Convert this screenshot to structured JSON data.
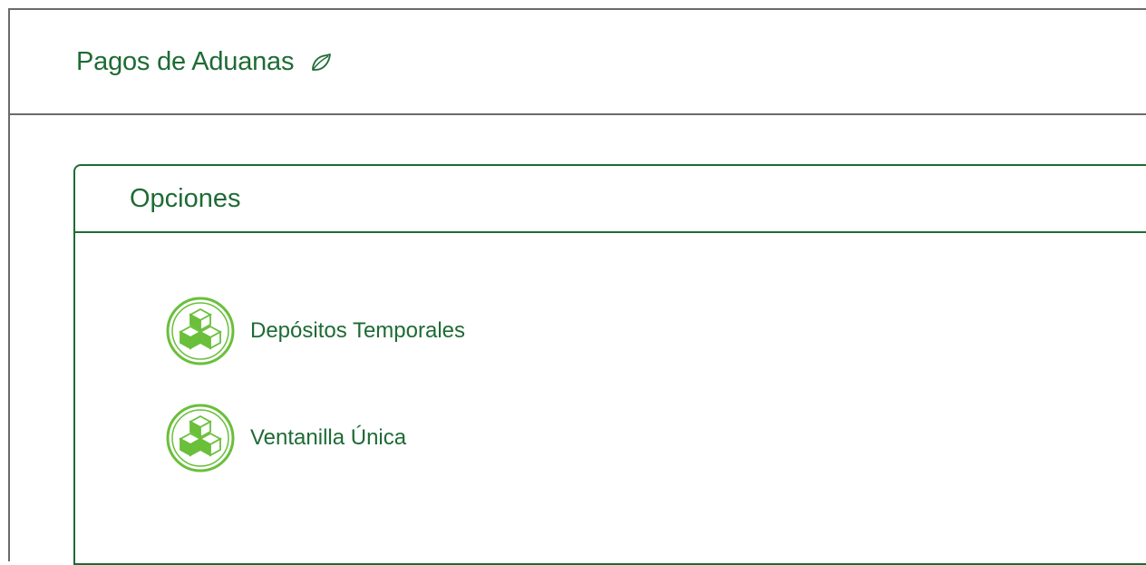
{
  "header": {
    "title": "Pagos de Aduanas",
    "icon": "leaf-icon"
  },
  "panel": {
    "title": "Opciones",
    "items": [
      {
        "label": "Depósitos Temporales",
        "icon": "boxes-icon"
      },
      {
        "label": "Ventanilla Única",
        "icon": "boxes-icon"
      }
    ]
  },
  "colors": {
    "primary": "#1e6b35",
    "icon_green": "#6abf3b",
    "frame_gray": "#6b6b6b"
  }
}
